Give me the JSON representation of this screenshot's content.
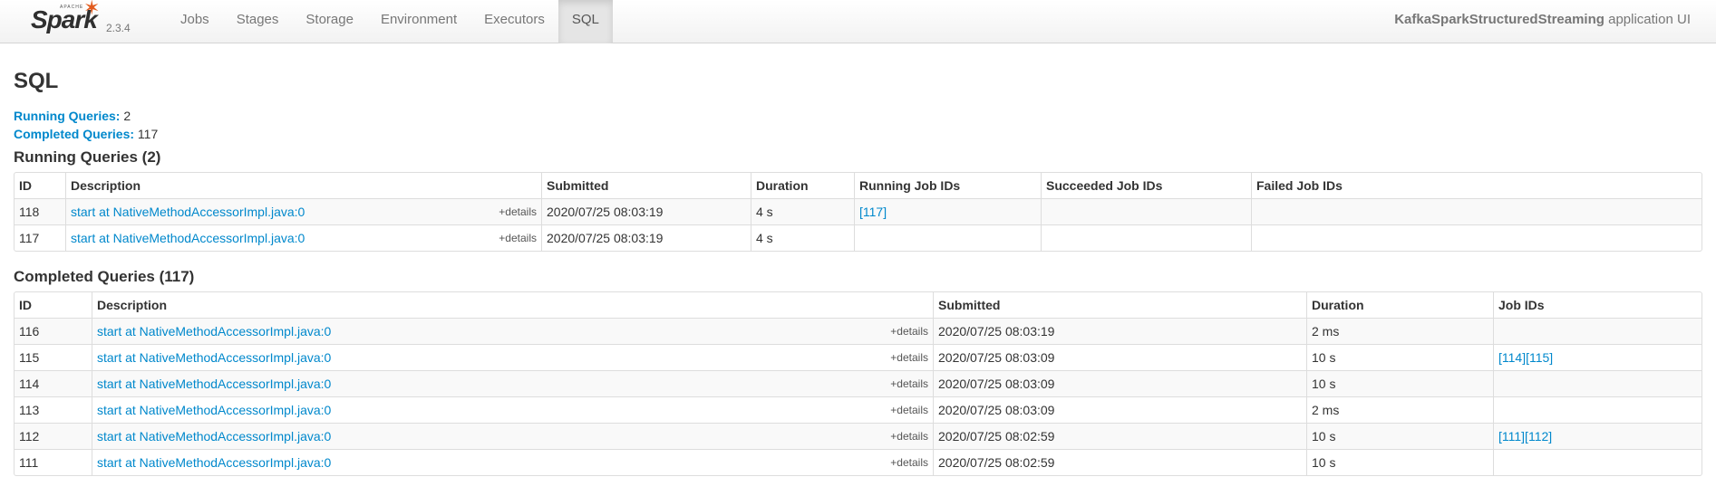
{
  "brand": {
    "apache": "APACHE",
    "spark": "Spark",
    "version": "2.3.4"
  },
  "nav": {
    "items": [
      "Jobs",
      "Stages",
      "Storage",
      "Environment",
      "Executors",
      "SQL"
    ],
    "active": "SQL"
  },
  "app": {
    "name": "KafkaSparkStructuredStreaming",
    "suffix": " application UI"
  },
  "page": {
    "title": "SQL",
    "running_label": "Running Queries:",
    "running_count": "2",
    "completed_label": "Completed Queries:",
    "completed_count": "117"
  },
  "running": {
    "heading": "Running Queries (2)",
    "columns": [
      "ID",
      "Description",
      "Submitted",
      "Duration",
      "Running Job IDs",
      "Succeeded Job IDs",
      "Failed Job IDs"
    ],
    "rows": [
      {
        "id": "118",
        "desc": "start at NativeMethodAccessorImpl.java:0",
        "details": "+details",
        "submitted": "2020/07/25 08:03:19",
        "duration": "4 s",
        "running": "[117]",
        "succeeded": "",
        "failed": ""
      },
      {
        "id": "117",
        "desc": "start at NativeMethodAccessorImpl.java:0",
        "details": "+details",
        "submitted": "2020/07/25 08:03:19",
        "duration": "4 s",
        "running": "",
        "succeeded": "",
        "failed": ""
      }
    ]
  },
  "completed": {
    "heading": "Completed Queries (117)",
    "columns": [
      "ID",
      "Description",
      "Submitted",
      "Duration",
      "Job IDs"
    ],
    "rows": [
      {
        "id": "116",
        "desc": "start at NativeMethodAccessorImpl.java:0",
        "details": "+details",
        "submitted": "2020/07/25 08:03:19",
        "duration": "2 ms",
        "jobs": ""
      },
      {
        "id": "115",
        "desc": "start at NativeMethodAccessorImpl.java:0",
        "details": "+details",
        "submitted": "2020/07/25 08:03:09",
        "duration": "10 s",
        "jobs": "[114][115]"
      },
      {
        "id": "114",
        "desc": "start at NativeMethodAccessorImpl.java:0",
        "details": "+details",
        "submitted": "2020/07/25 08:03:09",
        "duration": "10 s",
        "jobs": ""
      },
      {
        "id": "113",
        "desc": "start at NativeMethodAccessorImpl.java:0",
        "details": "+details",
        "submitted": "2020/07/25 08:03:09",
        "duration": "2 ms",
        "jobs": ""
      },
      {
        "id": "112",
        "desc": "start at NativeMethodAccessorImpl.java:0",
        "details": "+details",
        "submitted": "2020/07/25 08:02:59",
        "duration": "10 s",
        "jobs": "[111][112]"
      },
      {
        "id": "111",
        "desc": "start at NativeMethodAccessorImpl.java:0",
        "details": "+details",
        "submitted": "2020/07/25 08:02:59",
        "duration": "10 s",
        "jobs": ""
      }
    ]
  },
  "colors": {
    "link": "#0088cc",
    "brand_orange": "#e25a1c"
  }
}
